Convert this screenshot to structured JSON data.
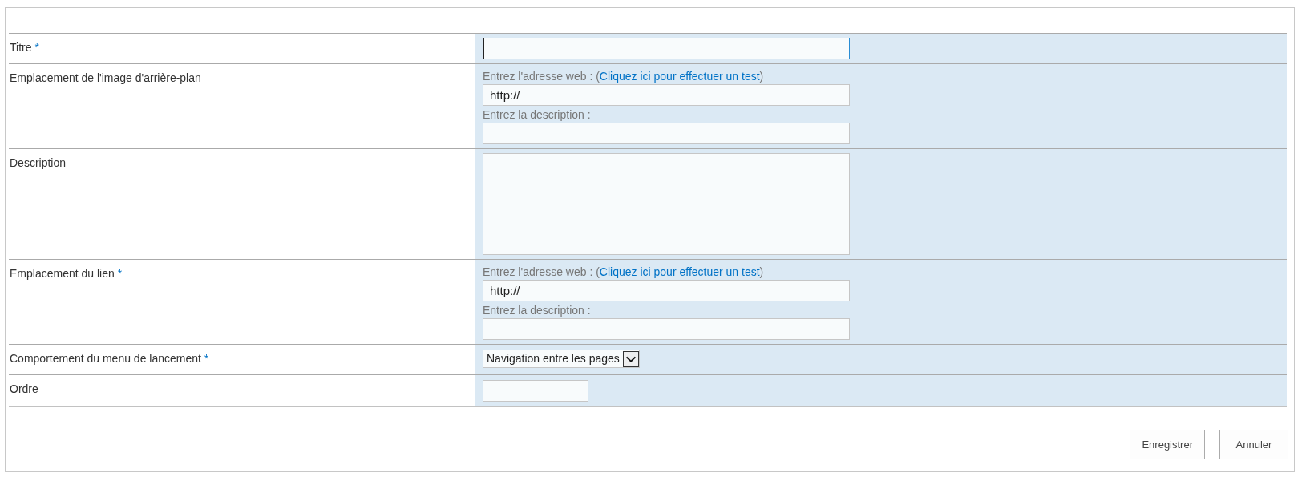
{
  "form": {
    "rows": [
      {
        "label": "Titre",
        "required": true,
        "kind": "text",
        "focused": true
      },
      {
        "label": "Emplacement de l'image d'arrière-plan",
        "required": false,
        "kind": "url",
        "url_prompt": "Entrez l'adresse web : (",
        "test_link": "Cliquez ici pour effectuer un test",
        "url_prompt_end": ")",
        "url_value": "http://",
        "description_prompt": "Entrez la description :"
      },
      {
        "label": "Description",
        "required": false,
        "kind": "textarea"
      },
      {
        "label": "Emplacement du lien",
        "required": true,
        "kind": "url",
        "url_prompt": "Entrez l'adresse web : (",
        "test_link": "Cliquez ici pour effectuer un test",
        "url_prompt_end": ")",
        "url_value": "http://",
        "description_prompt": "Entrez la description :"
      },
      {
        "label": "Comportement du menu de lancement",
        "required": true,
        "kind": "select",
        "value": "Navigation entre les pages"
      },
      {
        "label": "Ordre",
        "required": false,
        "kind": "short"
      }
    ],
    "required_mark": "*"
  },
  "buttons": [
    "Enregistrer",
    "Annuler"
  ]
}
